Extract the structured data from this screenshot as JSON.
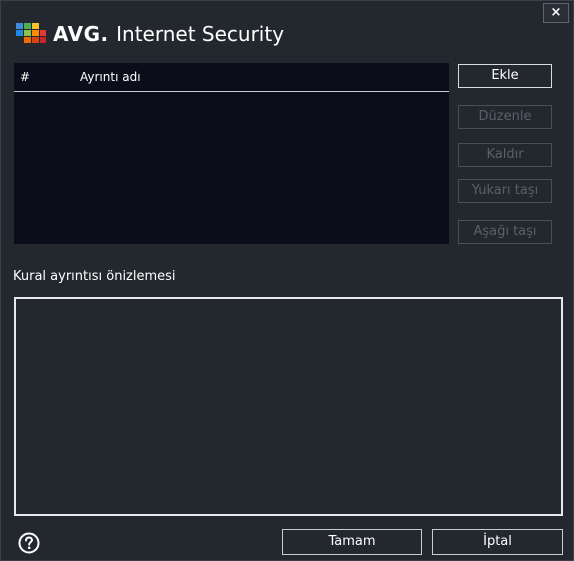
{
  "window": {
    "close_label": "×",
    "brand": "AVG",
    "brand_dot": ".",
    "product": "Internet Security"
  },
  "table": {
    "columns": [
      "#",
      "Ayrıntı adı"
    ],
    "rows": []
  },
  "buttons": {
    "add": "Ekle",
    "edit": "Düzenle",
    "remove": "Kaldır",
    "move_up": "Yukarı taşı",
    "move_down": "Aşağı taşı"
  },
  "preview": {
    "label": "Kural ayrıntısı önizlemesi"
  },
  "footer": {
    "ok": "Tamam",
    "cancel": "İptal"
  },
  "icons": {
    "logo": "avg-logo-icon",
    "help": "help-icon",
    "close": "close-icon"
  },
  "colors": {
    "background": "#23272e",
    "table_background": "#0b0e1a",
    "disabled_text": "#5b6068"
  }
}
